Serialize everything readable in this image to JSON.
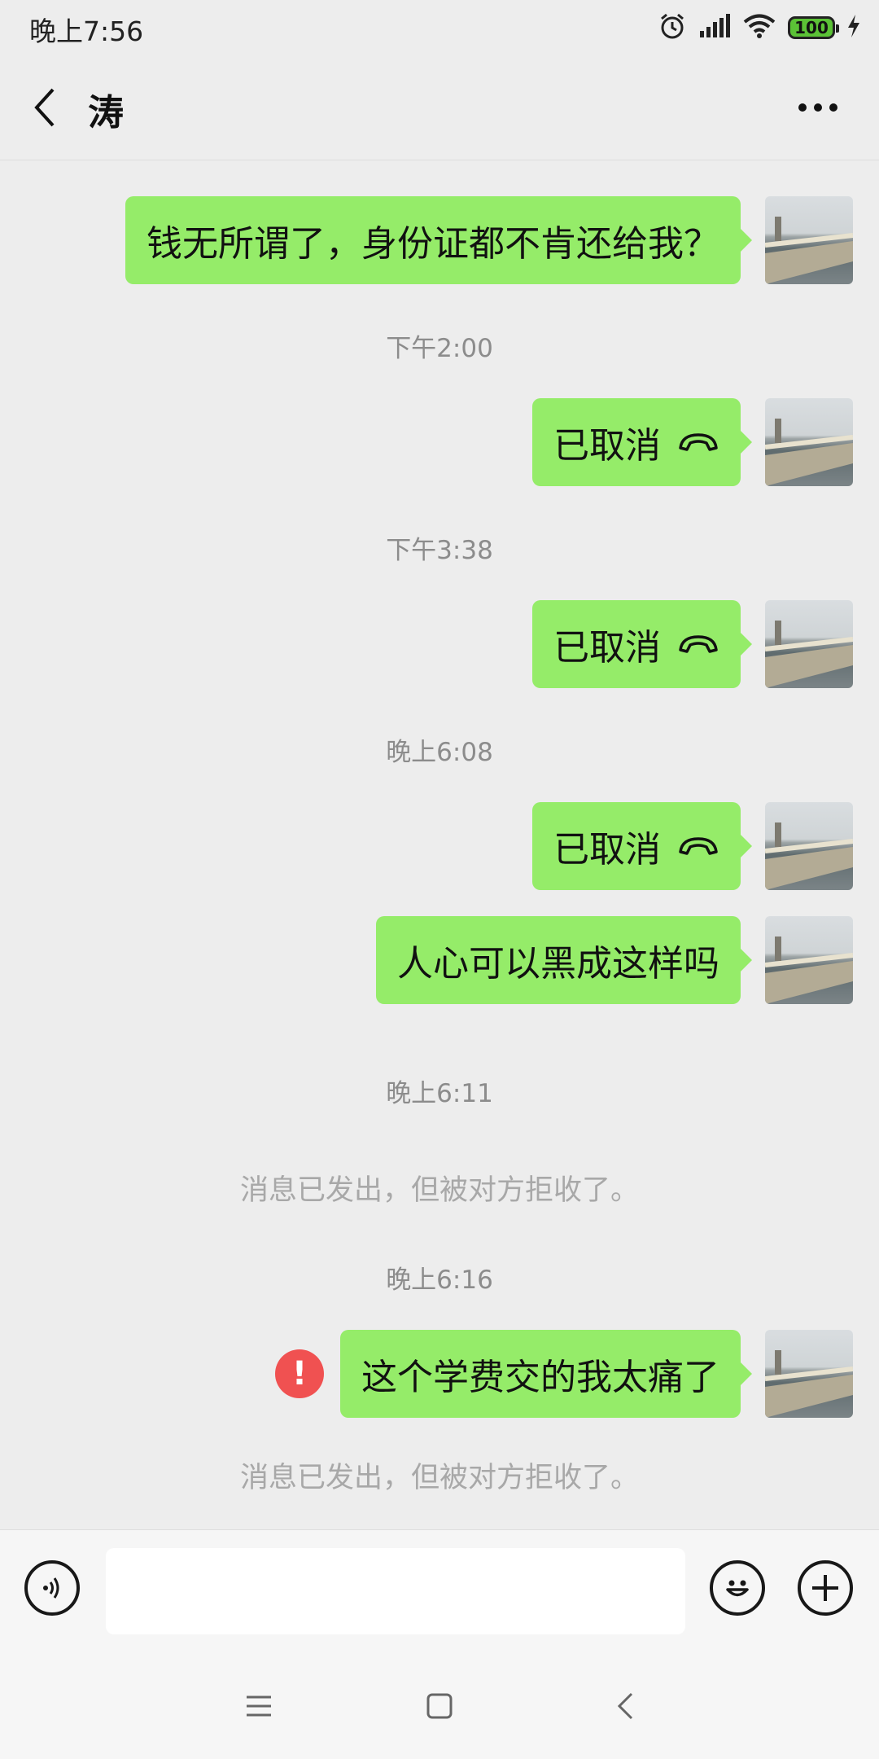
{
  "status_bar": {
    "time": "晚上7:56",
    "battery": "100"
  },
  "header": {
    "title": "涛"
  },
  "messages": [
    {
      "text": "钱无所谓了，身份证都不肯还给我？"
    },
    {
      "timestamp": "下午2:00",
      "text": "已取消",
      "icon": "hang-up-icon"
    },
    {
      "timestamp": "下午3:38",
      "text": "已取消",
      "icon": "hang-up-icon"
    },
    {
      "timestamp": "晚上6:08",
      "text": "已取消",
      "icon": "hang-up-icon"
    },
    {
      "text": "人心可以黑成这样吗"
    },
    {
      "timestamp": "晚上6:11",
      "system_note": "消息已发出，但被对方拒收了。"
    },
    {
      "timestamp": "晚上6:16",
      "text": "这个学费交的我太痛了",
      "status_icon": "error-icon",
      "system_note": "消息已发出，但被对方拒收了。"
    }
  ],
  "input_bar": {
    "value": "",
    "left_icon": "voice-icon",
    "icons": [
      "emoji-icon",
      "plus-icon"
    ]
  },
  "nav_bar": {
    "icons": [
      "menu-icon",
      "home-icon",
      "back-icon"
    ]
  },
  "colors": {
    "background": "#ededed",
    "bubble": "#95ec69",
    "error": "#f05151",
    "battery": "#5bc236"
  }
}
